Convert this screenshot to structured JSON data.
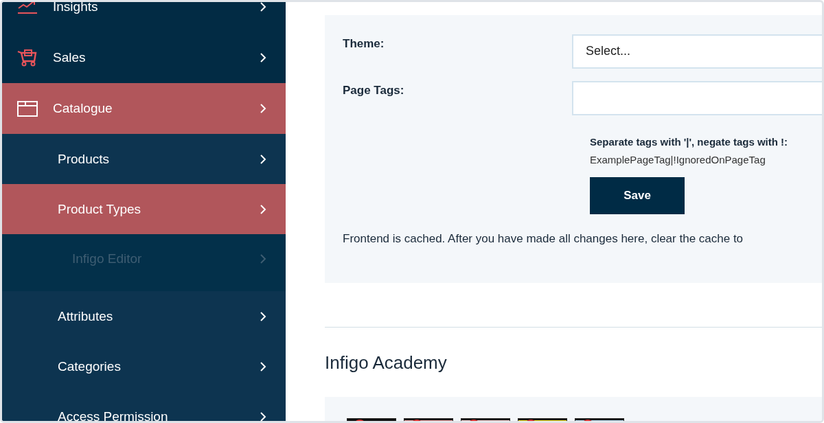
{
  "sidebar": {
    "items": [
      {
        "label": "Insights",
        "selected": false
      },
      {
        "label": "Sales",
        "selected": false
      },
      {
        "label": "Catalogue",
        "selected": true,
        "expanded": true,
        "children": [
          {
            "label": "Products",
            "selected": false
          },
          {
            "label": "Product Types",
            "selected": true,
            "expanded": true,
            "children": [
              {
                "label": "Infigo Editor",
                "selected": false,
                "disabled": true
              }
            ]
          },
          {
            "label": "Attributes",
            "selected": false
          },
          {
            "label": "Categories",
            "selected": false
          },
          {
            "label": "Access Permission",
            "selected": false
          }
        ]
      }
    ]
  },
  "settings": {
    "fields": [
      {
        "label": "Theme:",
        "value": "Select..."
      },
      {
        "label": "Page Tags:"
      }
    ],
    "help_title": "Separate tags with '|', negate tags with !:",
    "help_example": "ExamplePageTag|!IgnoredOnPageTag",
    "save_button": "Save",
    "note": "Frontend is cached. After you have made all changes here, clear the cache to"
  },
  "academy": {
    "title": "Infigo Academy"
  }
}
